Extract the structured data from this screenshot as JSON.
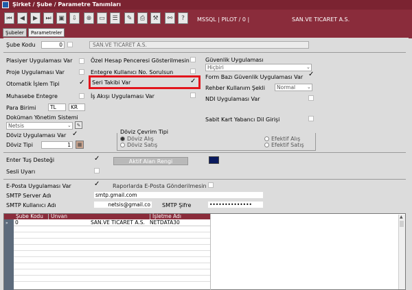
{
  "window": {
    "title": "Şirket / Şube / Parametre Tanımları"
  },
  "toolbar": {
    "connection": "MSSQL | PILOT / 0 |",
    "company": "SAN.VE TICARET A.S."
  },
  "tabs": [
    "Şubeler",
    "Parametreler"
  ],
  "branch": {
    "code_label": "Şube Kodu",
    "code_value": "0",
    "name_value": "SAN.VE TICARET A.S."
  },
  "left": {
    "plasiyer": "Plasiyer Uygulaması Var",
    "proje": "Proje Uygulaması Var",
    "otomatik": "Otomatik İşlem Tipi",
    "muhasebe": "Muhasebe Entegre",
    "para_birimi": "Para Birimi",
    "currency1": "TL",
    "currency2": "KR",
    "dokuman": "Doküman Yönetim Sistemi",
    "dokuman_value": "Netsis",
    "doviz_uyg": "Döviz Uygulaması Var",
    "doviz_tipi": "Döviz Tipi",
    "doviz_tipi_value": "1"
  },
  "middle": {
    "ozel_hesap": "Özel Hesap Penceresi Gösterilmesin",
    "entegre": "Entegre Kullanıcı No. Sorulsun",
    "seri": "Seri Takibi Var",
    "is_akisi": "İş Akışı Uygulaması Var"
  },
  "right": {
    "guvenlik": "Güvenlik Uygulaması",
    "guvenlik_value": "Hiçbiri",
    "form_bazi": "Form Bazı Güvenlik Uygulaması Var",
    "rehber": "Rehber Kullanım Şekli",
    "rehber_value": "Normal",
    "ndi": "NDI Uygulaması Var",
    "sabit_kart": "Sabit Kart Yabancı Dil Girişi"
  },
  "doviz_cevrim": {
    "title": "Döviz Çevrim Tipi",
    "opt1": "Döviz Alış",
    "opt2": "Döviz Satış",
    "opt3": "Efektif Alış",
    "opt4": "Efektif Satış"
  },
  "enter_tus": "Enter Tuş Desteği",
  "sesli": "Sesli Uyarı",
  "aktif_alan": "Aktif Alan Rengi",
  "aktif_color": "#0a1a5e",
  "eposta": {
    "label": "E-Posta Uygulaması Var",
    "raporlarda": "Raporlarda E-Posta Gönderilmesin",
    "smtp_server_label": "SMTP Server Adı",
    "smtp_server_value": "smtp.gmail.com",
    "smtp_user_label": "SMTP Kullanıcı Adı",
    "smtp_user_value": "netsis@gmail.co",
    "smtp_pass_label": "SMTP Şifre",
    "smtp_pass_value": "••••••••••••••"
  },
  "grid": {
    "headers": [
      "Şube Kodu",
      "Unvan",
      "İşletme Adı"
    ],
    "row": {
      "kod": "0",
      "unvan": "SAN.VE TICARET A.S.",
      "isletme": "NETDATA30"
    }
  },
  "colors": {
    "title_bg": "#7b2331",
    "toolbar_bg": "#8a2c3b",
    "highlight": "#e3141b"
  }
}
